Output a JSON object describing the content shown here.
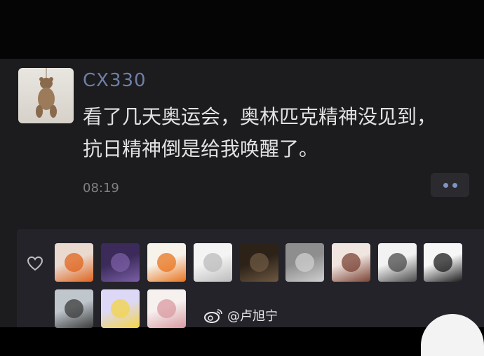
{
  "post": {
    "author": "CX330",
    "lines": "看了几天奥运会，奥林匹克精神没见到，\n抗日精神倒是给我唤醒了。",
    "time": "08:19"
  },
  "likes": {
    "icon": "heart-outline-icon",
    "avatars": [
      {
        "name": "sushi-avatar",
        "colors": [
          "#e9d9cf",
          "#e0641c"
        ]
      },
      {
        "name": "anime-dark-avatar",
        "colors": [
          "#3b2a5a",
          "#7b5fa6"
        ]
      },
      {
        "name": "pumpkin-avatar",
        "colors": [
          "#f7f2ea",
          "#e8741d"
        ]
      },
      {
        "name": "sketch-girl-avatar",
        "colors": [
          "#f4f4f4",
          "#bcbcbc"
        ]
      },
      {
        "name": "dark-photo-avatar",
        "colors": [
          "#2c2218",
          "#6e5841"
        ]
      },
      {
        "name": "cat-photo-avatar",
        "colors": [
          "#8e8e8e",
          "#cfcfcf"
        ]
      },
      {
        "name": "anime-brown-hair-avatar",
        "colors": [
          "#f1e5e0",
          "#7a4334"
        ]
      },
      {
        "name": "manga-figure-avatar",
        "colors": [
          "#f2f2f2",
          "#4a4a4a"
        ]
      },
      {
        "name": "manga-black-hair-avatar",
        "colors": [
          "#f7f7f7",
          "#1d1d1d"
        ]
      },
      {
        "name": "photo-girl-avatar",
        "colors": [
          "#bfc6cc",
          "#3b3b3b"
        ]
      },
      {
        "name": "chick-avatar",
        "colors": [
          "#ddd8f5",
          "#f3d447"
        ]
      },
      {
        "name": "pink-hair-girl-avatar",
        "colors": [
          "#f6f0ef",
          "#d99aa0"
        ]
      }
    ]
  },
  "watermark": {
    "icon": "weibo-icon",
    "text": "@卢旭宁"
  }
}
